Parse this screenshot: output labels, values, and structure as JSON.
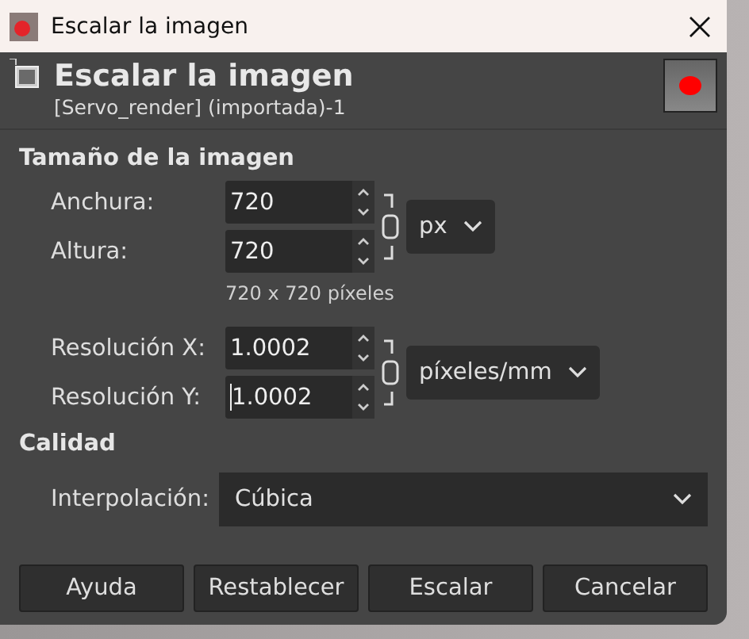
{
  "window": {
    "title": "Escalar la imagen"
  },
  "header": {
    "title": "Escalar la imagen",
    "subtitle": "[Servo_render] (importada)-1"
  },
  "size_section": {
    "title": "Tamaño de la imagen",
    "fields": [
      {
        "label": "Anchura:",
        "value": "720"
      },
      {
        "label": "Altura:",
        "value": "720"
      }
    ],
    "unit": "px",
    "summary": "720 x 720 píxeles"
  },
  "resolution": {
    "fields": [
      {
        "label": "Resolución X:",
        "value": "1.0002"
      },
      {
        "label": "Resolución Y:",
        "value": "1.0002",
        "focused": true
      }
    ],
    "unit": "píxeles/mm"
  },
  "quality": {
    "title": "Calidad",
    "label": "Interpolación:",
    "value": "Cúbica"
  },
  "buttons": [
    "Ayuda",
    "Restablecer",
    "Escalar",
    "Cancelar"
  ]
}
